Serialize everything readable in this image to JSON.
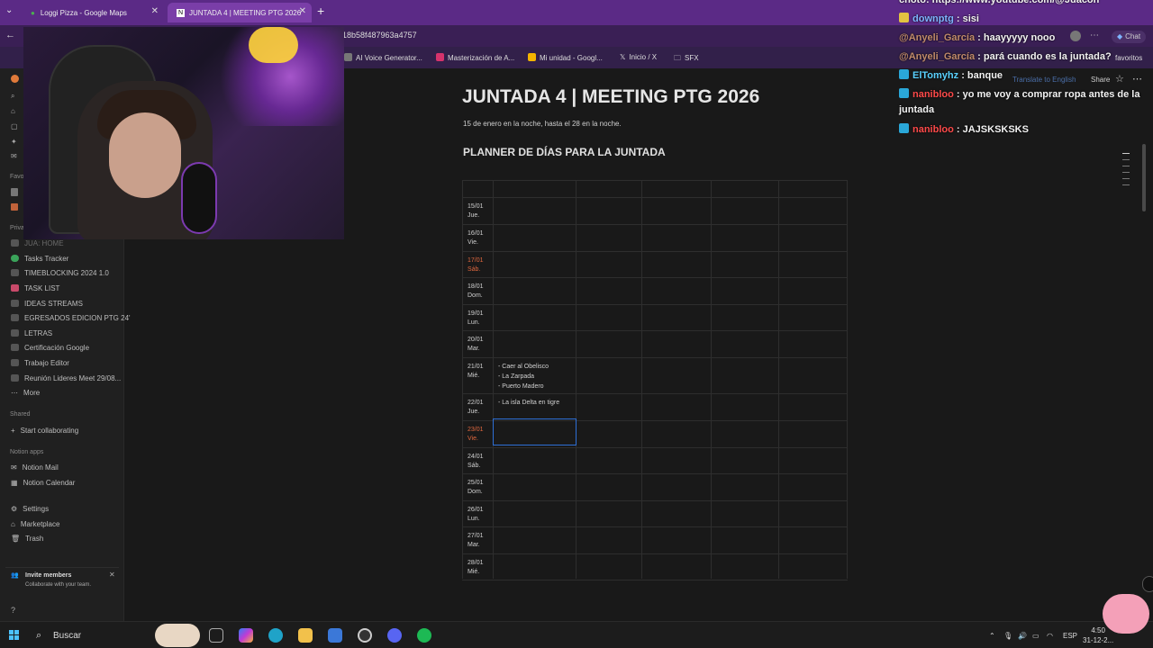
{
  "browser": {
    "tabs": [
      {
        "label": "Loggi Pizza - Google Maps"
      },
      {
        "label": "JUNTADA 4 | MEETING PTG 2026"
      }
    ],
    "url": "18b58f487963a4757",
    "bookmarks": [
      "AI Voice Generator...",
      "Masterización de A...",
      "Mi unidad - Googl...",
      "Inicio / X",
      "SFX"
    ],
    "chat_button": "Chat",
    "favoritos": "favoritos"
  },
  "sidebar": {
    "favorites_head": "Favo",
    "private_head": "Priva",
    "items": [
      "JUA: HOME",
      "Tasks Tracker",
      "TIMEBLOCKING 2024 1.0",
      "TASK LIST",
      "IDEAS STREAMS",
      "EGRESADOS EDICION PTG 24'",
      "LETRAS",
      "Certificación Google",
      "Trabajo Editor",
      "Reunión Lideres Meet 29/08...",
      "More"
    ],
    "shared_head": "Shared",
    "start_collab": "Start collaborating",
    "apps_head": "Notion apps",
    "apps": [
      "Notion Mail",
      "Notion Calendar"
    ],
    "bottom": [
      "Settings",
      "Marketplace",
      "Trash"
    ],
    "invite_title": "Invite members",
    "invite_sub": "Collaborate with your team."
  },
  "page": {
    "title": "JUNTADA 4 | MEETING PTG 2026",
    "subtitle": "15 de enero en la noche, hasta el 28 en la noche.",
    "planner_title": "PLANNER DE DÍAS PARA LA JUNTADA",
    "translate": "Translate to English",
    "share": "Share",
    "rows": [
      {
        "date": "15/01",
        "day": "Jue.",
        "weekend": false,
        "text": []
      },
      {
        "date": "16/01",
        "day": "Vie.",
        "weekend": false,
        "text": []
      },
      {
        "date": "17/01",
        "day": "Sáb.",
        "weekend": true,
        "text": []
      },
      {
        "date": "18/01",
        "day": "Dom.",
        "weekend": false,
        "text": []
      },
      {
        "date": "19/01",
        "day": "Lun.",
        "weekend": false,
        "text": []
      },
      {
        "date": "20/01",
        "day": "Mar.",
        "weekend": false,
        "text": []
      },
      {
        "date": "21/01",
        "day": "Mié.",
        "weekend": false,
        "text": [
          "- Caer al Obelisco",
          "- La Zarpada",
          "- Puerto Madero"
        ]
      },
      {
        "date": "22/01",
        "day": "Jue.",
        "weekend": false,
        "text": [
          "- La isla Delta en tigre"
        ]
      },
      {
        "date": "23/01",
        "day": "Vie.",
        "weekend": true,
        "text": []
      },
      {
        "date": "24/01",
        "day": "Sáb.",
        "weekend": false,
        "text": []
      },
      {
        "date": "25/01",
        "day": "Dom.",
        "weekend": false,
        "text": []
      },
      {
        "date": "26/01",
        "day": "Lun.",
        "weekend": false,
        "text": []
      },
      {
        "date": "27/01",
        "day": "Mar.",
        "weekend": false,
        "text": []
      },
      {
        "date": "28/01",
        "day": "Mié.",
        "weekend": false,
        "text": []
      }
    ]
  },
  "chat": [
    {
      "user": "",
      "msg": "choto: https://www.youtube.com/@Juacon",
      "color": "#f2f2f2"
    },
    {
      "user": "downptg",
      "msg": " : sisi",
      "color": "#7fb4ff"
    },
    {
      "user": "@Anyeli_García",
      "msg": " : haayyyyy nooo",
      "color": "#c08a6a"
    },
    {
      "user": "@Anyeli_García",
      "msg": " : pará cuando es la juntada?",
      "color": "#c08a6a"
    },
    {
      "user": "ElTomyhz",
      "msg": " : banque",
      "color": "#5ad1ff"
    },
    {
      "user": "nanibloo",
      "msg": " : yo me voy a comprar ropa antes de la juntada",
      "color": "#ff4a4a"
    },
    {
      "user": "nanibloo",
      "msg": " : JAJSKSKSKS",
      "color": "#ff4a4a"
    }
  ],
  "taskbar": {
    "search": "Buscar",
    "lang": "ESP",
    "time": "4:50",
    "date": "31-12-2..."
  }
}
